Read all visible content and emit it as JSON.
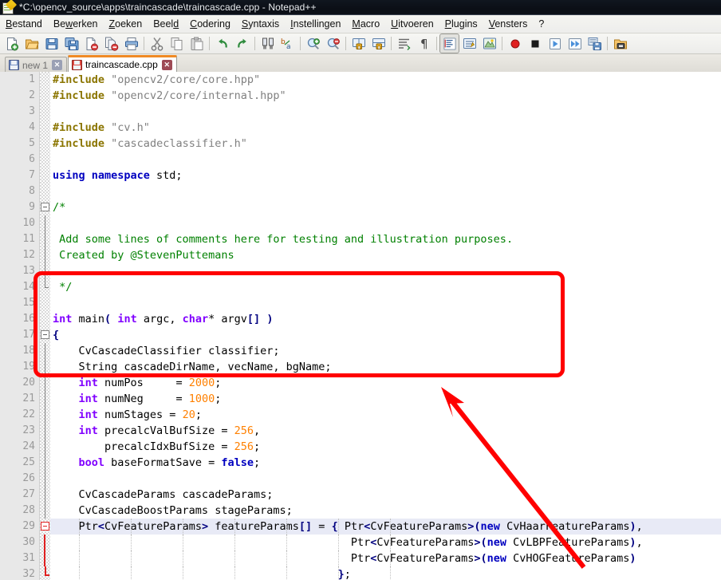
{
  "window": {
    "title": "*C:\\opencv_source\\apps\\traincascade\\traincascade.cpp - Notepad++",
    "app_icon": "notepad-plus-plus-icon"
  },
  "menu": {
    "items": [
      {
        "label": "Bestand",
        "accel": "B"
      },
      {
        "label": "Bewerken",
        "accel": "w"
      },
      {
        "label": "Zoeken",
        "accel": "Z"
      },
      {
        "label": "Beeld",
        "accel": "d"
      },
      {
        "label": "Codering",
        "accel": "C"
      },
      {
        "label": "Syntaxis",
        "accel": "S"
      },
      {
        "label": "Instellingen",
        "accel": "I"
      },
      {
        "label": "Macro",
        "accel": "M"
      },
      {
        "label": "Uitvoeren",
        "accel": "U"
      },
      {
        "label": "Plugins",
        "accel": "P"
      },
      {
        "label": "Vensters",
        "accel": "V"
      },
      {
        "label": "?",
        "accel": ""
      }
    ]
  },
  "toolbar": {
    "groups": [
      [
        "new-file-icon",
        "open-file-icon",
        "save-icon",
        "save-all-icon",
        "close-file-icon",
        "close-all-icon",
        "print-icon"
      ],
      [
        "cut-icon",
        "copy-icon",
        "paste-icon"
      ],
      [
        "undo-icon",
        "redo-icon"
      ],
      [
        "find-icon",
        "replace-icon"
      ],
      [
        "zoom-in-icon",
        "zoom-out-icon"
      ],
      [
        "sync-vertical-scroll-icon",
        "sync-horizontal-scroll-icon"
      ],
      [
        "word-wrap-icon",
        "show-all-characters-icon"
      ],
      [
        "indent-guide-icon",
        "function-list-icon",
        "document-map-icon"
      ],
      [
        "macro-record-icon",
        "macro-stop-icon",
        "macro-play-icon",
        "macro-run-multiple-icon",
        "macro-save-icon"
      ],
      [
        "run-icon"
      ]
    ]
  },
  "tabs": [
    {
      "label": "new 1",
      "active": false,
      "modified": false,
      "icon": "floppy-blue-icon",
      "close": "✕"
    },
    {
      "label": "traincascade.cpp",
      "active": true,
      "modified": true,
      "icon": "floppy-red-icon",
      "close": "✕"
    }
  ],
  "editor": {
    "current_line": 29,
    "colors": {
      "preprocessor": "#8b7500",
      "string": "#808080",
      "keyword": "#0000c0",
      "type": "#8000ff",
      "number": "#ff8000",
      "comment": "#008000",
      "operator": "#000080",
      "current_line_bg": "#e8eaf6",
      "gutter_bg": "#e8e8e8",
      "line_number": "#9a9a9a"
    },
    "lines": [
      {
        "n": 1,
        "fold": "",
        "html": "<span class=\"k-pre\">#include</span> <span class=\"k-str\">\"opencv2/core/core.hpp\"</span>"
      },
      {
        "n": 2,
        "fold": "",
        "html": "<span class=\"k-pre\">#include</span> <span class=\"k-str\">\"opencv2/core/internal.hpp\"</span>"
      },
      {
        "n": 3,
        "fold": "",
        "html": ""
      },
      {
        "n": 4,
        "fold": "",
        "html": "<span class=\"k-pre\">#include</span> <span class=\"k-str\">\"cv.h\"</span>"
      },
      {
        "n": 5,
        "fold": "",
        "html": "<span class=\"k-pre\">#include</span> <span class=\"k-str\">\"cascadeclassifier.h\"</span>"
      },
      {
        "n": 6,
        "fold": "",
        "html": ""
      },
      {
        "n": 7,
        "fold": "",
        "html": "<span class=\"k-kw\">using namespace</span> std;"
      },
      {
        "n": 8,
        "fold": "",
        "html": ""
      },
      {
        "n": 9,
        "fold": "box",
        "html": "<span class=\"k-cmt\">/*</span>"
      },
      {
        "n": 10,
        "fold": "line",
        "html": ""
      },
      {
        "n": 11,
        "fold": "line",
        "html": "<span class=\"k-cmt\"> Add some lines of comments here for testing and illustration purposes.</span>"
      },
      {
        "n": 12,
        "fold": "line",
        "html": "<span class=\"k-cmt\"> Created by @StevenPuttemans</span>"
      },
      {
        "n": 13,
        "fold": "line",
        "html": ""
      },
      {
        "n": 14,
        "fold": "end",
        "html": "<span class=\"k-cmt\"> */</span>"
      },
      {
        "n": 15,
        "fold": "",
        "html": ""
      },
      {
        "n": 16,
        "fold": "",
        "html": "<span class=\"k-type\">int</span> main<span class=\"k-op\">(</span> <span class=\"k-type\">int</span> argc, <span class=\"k-type\">char</span>* argv<span class=\"k-op\">[]</span> <span class=\"k-op\">)</span>"
      },
      {
        "n": 17,
        "fold": "box",
        "html": "<span class=\"k-op\">{</span>"
      },
      {
        "n": 18,
        "fold": "line",
        "html": "    CvCascadeClassifier classifier;"
      },
      {
        "n": 19,
        "fold": "line",
        "html": "    String cascadeDirName, vecName, bgName;"
      },
      {
        "n": 20,
        "fold": "line",
        "html": "    <span class=\"k-type\">int</span> numPos     = <span class=\"k-num\">2000</span>;"
      },
      {
        "n": 21,
        "fold": "line",
        "html": "    <span class=\"k-type\">int</span> numNeg     = <span class=\"k-num\">1000</span>;"
      },
      {
        "n": 22,
        "fold": "line",
        "html": "    <span class=\"k-type\">int</span> numStages = <span class=\"k-num\">20</span>;"
      },
      {
        "n": 23,
        "fold": "line",
        "html": "    <span class=\"k-type\">int</span> precalcValBufSize = <span class=\"k-num\">256</span>,"
      },
      {
        "n": 24,
        "fold": "line",
        "html": "        precalcIdxBufSize = <span class=\"k-num\">256</span>;"
      },
      {
        "n": 25,
        "fold": "line",
        "html": "    <span class=\"k-type\">bool</span> baseFormatSave = <span class=\"k-kw\">false</span>;"
      },
      {
        "n": 26,
        "fold": "line",
        "html": ""
      },
      {
        "n": 27,
        "fold": "line",
        "html": "    CvCascadeParams cascadeParams;"
      },
      {
        "n": 28,
        "fold": "line",
        "html": "    CvCascadeBoostParams stageParams;"
      },
      {
        "n": 29,
        "fold": "box-red",
        "html": "    Ptr<span class=\"k-op\">&lt;</span>CvFeatureParams<span class=\"k-op\">&gt;</span> featureParams<span class=\"k-op\">[]</span> = <span class=\"k-op\">{</span> Ptr<span class=\"k-op\">&lt;</span>CvFeatureParams<span class=\"k-op\">&gt;(</span><span class=\"k-kw\">new</span> CvHaarFeatureParams<span class=\"k-op\">)</span>,"
      },
      {
        "n": 30,
        "fold": "line-red",
        "html": "                                              Ptr<span class=\"k-op\">&lt;</span>CvFeatureParams<span class=\"k-op\">&gt;(</span><span class=\"k-kw\">new</span> CvLBPFeatureParams<span class=\"k-op\">)</span>,"
      },
      {
        "n": 31,
        "fold": "line-red",
        "html": "                                              Ptr<span class=\"k-op\">&lt;</span>CvFeatureParams<span class=\"k-op\">&gt;(</span><span class=\"k-kw\">new</span> CvHOGFeatureParams<span class=\"k-op\">)</span>"
      },
      {
        "n": 32,
        "fold": "end-red",
        "html": "                                            <span class=\"k-op\">}</span>;"
      }
    ]
  },
  "annotations": {
    "highlight_rectangle": {
      "name": "comment-block-highlight",
      "color": "#ff0000"
    },
    "arrow": {
      "name": "pointer-arrow",
      "color": "#ff0000"
    }
  }
}
